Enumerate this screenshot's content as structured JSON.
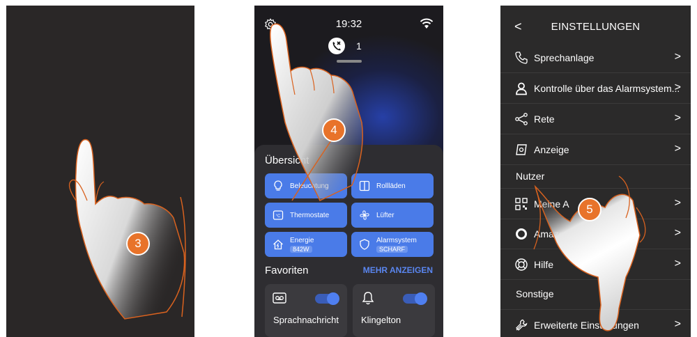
{
  "steps": [
    "3",
    "4",
    "5"
  ],
  "home": {
    "time": "19:32",
    "missed_calls": "1",
    "overview_title": "Übersicht",
    "tiles": [
      {
        "label": "Beleuchtung",
        "icon": "bulb-icon"
      },
      {
        "label": "Rollläden",
        "icon": "shutter-icon"
      },
      {
        "label": "Thermostate",
        "icon": "thermostat-icon"
      },
      {
        "label": "Lüfter",
        "icon": "fan-icon"
      },
      {
        "label": "Energie",
        "sub": "842W",
        "icon": "energy-icon"
      },
      {
        "label": "Alarmsystem",
        "sub": "SCHARF",
        "icon": "shield-icon"
      }
    ],
    "favorites_title": "Favoriten",
    "more_label": "MEHR ANZEIGEN",
    "favorites": [
      {
        "label": "Sprachnachricht",
        "icon": "voicemail-icon",
        "on": true
      },
      {
        "label": "Klingelton",
        "icon": "bell-icon",
        "on": true
      }
    ]
  },
  "settings": {
    "title": "EINSTELLUNGEN",
    "rows": [
      {
        "label": "Sprechanlage",
        "icon": "phone-icon"
      },
      {
        "label": "Kontrolle über das Alarmsystem...",
        "icon": "user-icon"
      },
      {
        "label": "Rete",
        "icon": "share-icon"
      },
      {
        "label": "Anzeige",
        "icon": "display-icon"
      }
    ],
    "section_users": "Nutzer",
    "user_rows": [
      {
        "label": "Meine A",
        "icon": "qr-icon"
      },
      {
        "label": "Amazon Alexa",
        "icon": "alexa-icon"
      },
      {
        "label": "Hilfe",
        "icon": "help-icon"
      }
    ],
    "section_other": "Sonstige",
    "other_rows": [
      {
        "label": "Erweiterte Einstellungen",
        "icon": "wrench-icon"
      }
    ]
  },
  "colors": {
    "accent": "#4a7be8",
    "step": "#e8732a",
    "hand_outline": "#d9621f"
  }
}
